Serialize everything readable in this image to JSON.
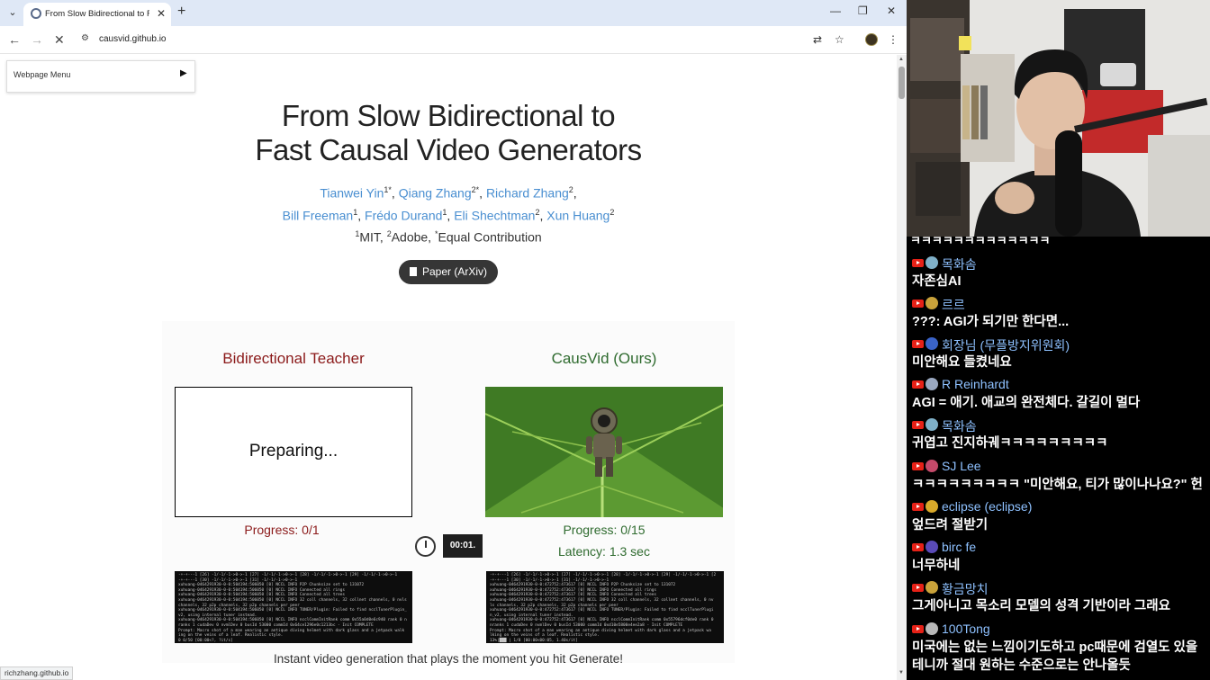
{
  "browser": {
    "tab_title": "From Slow Bidirectional to Fa",
    "url": "causvid.github.io",
    "status_url": "richzhang.github.io"
  },
  "page": {
    "webpage_menu_label": "Webpage Menu",
    "title_line1": "From Slow Bidirectional to",
    "title_line2": "Fast Causal Video Generators",
    "authors": {
      "a1": "Tianwei Yin",
      "a1_sup": "1*",
      "a2": "Qiang Zhang",
      "a2_sup": "2*",
      "a3": "Richard Zhang",
      "a3_sup": "2",
      "a4": "Bill Freeman",
      "a4_sup": "1",
      "a5": "Frédo Durand",
      "a5_sup": "1",
      "a6": "Eli Shechtman",
      "a6_sup": "2",
      "a7": "Xun Huang",
      "a7_sup": "2"
    },
    "affiliation": {
      "sup1": "1",
      "mit": "MIT, ",
      "sup2": "2",
      "adobe": "Adobe, ",
      "sup3": "*",
      "equal": "Equal Contribution"
    },
    "paper_button": "Paper (ArXiv)",
    "left_column": {
      "heading": "Bidirectional Teacher",
      "video_status": "Preparing...",
      "progress": "Progress: 0/1",
      "terminal_lines": [
        "-+-+---1 [26] -1/-1/-1->0->-1 [27] -1/-1/-1->0->-1 [28] -1/-1/-1->0->-1 [29] -1/-1/-1->0->-1",
        "-+-+---1 [30] -1/-1/-1->0->-1 [31] -1/-1/-1->0->-1",
        "xuhuang-0464291930-0-0:504194:506050 [0] NCCL INFO P2P Chunksize set to 131072",
        "xuhuang-0464291930-0-0:504194:506050 [0] NCCL INFO Connected all rings",
        "xuhuang-0464291930-0-0:504194:506050 [0] NCCL INFO Connected all trees",
        "xuhuang-0464291930-0-0:504194:506050 [0] NCCL INFO 32 coll channels, 32 collnet channels, 0 nvls",
        " channels, 32 p2p channels, 32 p2p channels per peer",
        "xuhuang-0464291930-0-0:504194:506050 [0] NCCL INFO TUNER/Plugin: Failed to find ncclTunerPlugin_",
        "v2, using internal tuner instead.",
        "xuhuang-0464291930-0-0:504194:506050 [0] NCCL INFO ncclCommInitRank comm 0x55a0d0e6c940 rank 0 n",
        "ranks 1 cudaDev 0 nvmlDev 0 busId 53000 commId 0x64ce1296e0c1213bc - Init COMPLETE",
        "Prompt:  Macro shot of a man wearing an antique diving helmet with dark glass and a jetpack walk",
        "ing on the veins of a leaf. Realistic style.",
        "                                              0 0/50 [00:00<?, ?it/s]"
      ]
    },
    "right_column": {
      "heading": "CausVid (Ours)",
      "progress": "Progress: 0/15",
      "latency": "Latency: 1.3 sec",
      "terminal_lines": [
        "-+-+---1 [26] -1/-1/-1->0->-1 [27] -1/-1/-1->0->-1 [28] -1/-1/-1->0->-1 [29] -1/-1/-1->0->-1 [2",
        "-+-+---1 [30] -1/-1/-1->0->-1 [31] -1/-1/-1->0->-1",
        "xuhuang-0464291930-0-0:472752:473617 [0] NCCL INFO P2P Chunksize set to 131072",
        "xuhuang-0464291930-0-0:472752:473617 [0] NCCL INFO Connected all rings",
        "xuhuang-0464291930-0-0:472752:473617 [0] NCCL INFO Connected all trees",
        "xuhuang-0464291930-0-0:472752:473617 [0] NCCL INFO 32 coll channels, 32 collnet channels, 0 nv",
        "ls channels, 32 p2p channels, 32 p2p channels per peer",
        "xuhuang-0464291930-0-0:472752:473617 [0] NCCL INFO TUNER/Plugin: Failed to find ncclTunerPlugi",
        "n_v2, using internal tuner instead.",
        "xuhuang-0464291930-0-0:472752:473617 [0] NCCL INFO ncclCommInitRank comm 0x55796dcf0de0 rank 0",
        "nranks 1 cudaDev 0 nvmlDev 0 busId 53000 commId 0xd10e5800e4ee2a8 - Init COMPLETE",
        "Prompt:  Macro shot of a man wearing an antique diving helmet with dark glass and a jetpack wa",
        "lking on the veins of a leaf. Realistic style.",
        "  13%|███                               | 1/8 [00:00<00:05,  1.40s/it]"
      ]
    },
    "timer_value": "00:01.",
    "footer_text": "Instant video generation that plays the moment you hit Generate!"
  },
  "chat": {
    "top_partial": "ㅋㅋㅋㅋㅋㅋㅋㅋㅋㅋㅋㅋㅋ",
    "messages": [
      {
        "name": "목화솜",
        "text": "자존심AI"
      },
      {
        "name": "르르",
        "text": "???: AGI가 되기만 한다면..."
      },
      {
        "name": "회장님 (무플방지위원회)",
        "text": "미안해요 들켰네요"
      },
      {
        "name": "R Reinhardt",
        "text": "AGI = 애기. 애교의 완전체다. 갈길이 멀다"
      },
      {
        "name": "목화솜",
        "text": "귀엽고 진지하궤ㅋㅋㅋㅋㅋㅋㅋㅋㅋ"
      },
      {
        "name": "SJ Lee",
        "text": "ㅋㅋㅋㅋㅋㅋㅋㅋㅋ \"미안해요, 티가 많이나나요?\" 헌"
      },
      {
        "name": "eclipse (eclipse)",
        "text": "엎드려 절받기"
      },
      {
        "name": "birc fe",
        "text": "너무하네"
      },
      {
        "name": "황금망치",
        "text": "그게아니고 목소리 모델의 성격 기반이라 그래요"
      },
      {
        "name": "100Tong",
        "text": "미국에는 없는 느낌이기도하고 pc때문에 검열도 있을"
      },
      {
        "name": "",
        "text": "테니까 절대 원하는 수준으로는 안나올듯"
      }
    ]
  },
  "colors": {
    "link": "#4a8fd1",
    "teacher": "#8b1a1a",
    "ours": "#2f6b2f",
    "chat_name": "#8ec1ff",
    "yt_red": "#e62117"
  }
}
